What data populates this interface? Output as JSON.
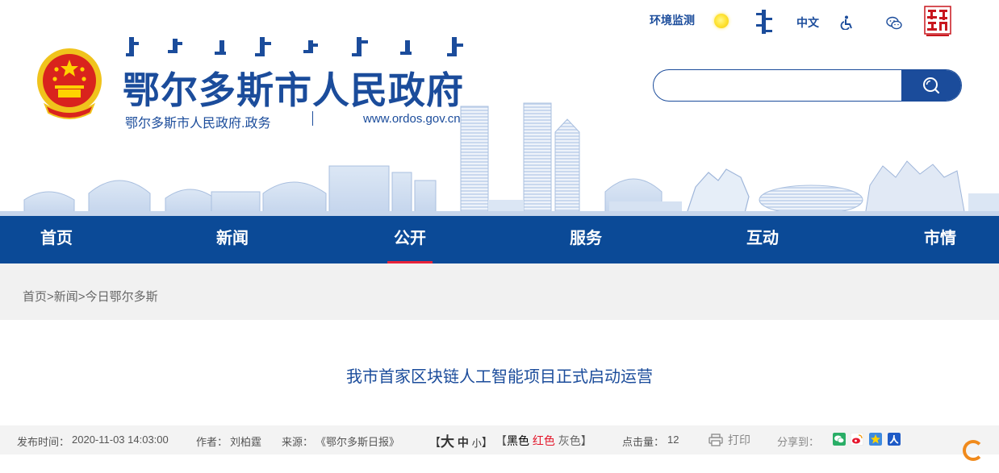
{
  "header": {
    "site_title": "鄂尔多斯市人民政府",
    "site_subtitle": "鄂尔多斯市人民政府.政务",
    "site_url": "www.ordos.gov.cn",
    "toplinks": {
      "environment": "环境监测",
      "chinese": "中文"
    },
    "search": {
      "placeholder": "",
      "value": ""
    }
  },
  "nav": {
    "items": [
      {
        "label": "首页"
      },
      {
        "label": "新闻"
      },
      {
        "label": "公开"
      },
      {
        "label": "服务"
      },
      {
        "label": "互动"
      },
      {
        "label": "市情"
      }
    ],
    "active_index": 2
  },
  "breadcrumb": {
    "items": [
      "首页",
      "新闻",
      "今日鄂尔多斯"
    ],
    "separator": ">"
  },
  "article": {
    "title": "我市首家区块链人工智能项目正式启动运营",
    "meta": {
      "publish_label": "发布时间：",
      "publish_time": "2020-11-03 14:03:00",
      "author_label": "作者：",
      "author": "刘柏霆",
      "source_label": "来源：",
      "source": "《鄂尔多斯日报》",
      "font_open": "【",
      "font_big": "大",
      "font_mid": "中",
      "font_small": "小",
      "font_close": "】",
      "color_open": "【",
      "color_black": "黑色",
      "color_red": "红色",
      "color_gray": "灰色",
      "color_close": "】",
      "clicks_label": "点击量：",
      "clicks": "12",
      "print_label": "打印",
      "share_label": "分享到："
    }
  },
  "colors": {
    "brand_blue": "#0b4a97",
    "title_blue": "#1b4c9b",
    "active_red": "#e8233a",
    "loader_orange": "#f08a1c"
  },
  "icons": {
    "sun": "weather-sun-icon",
    "mongolian": "mongolian-script-icon",
    "accessibility": "wheelchair-icon",
    "wechat": "wechat-icon",
    "seal": "ordos-online-seal",
    "search": "search-icon",
    "print": "printer-icon",
    "share": [
      "wechat-share-icon",
      "weibo-share-icon",
      "qzone-share-icon",
      "renren-share-icon"
    ]
  }
}
